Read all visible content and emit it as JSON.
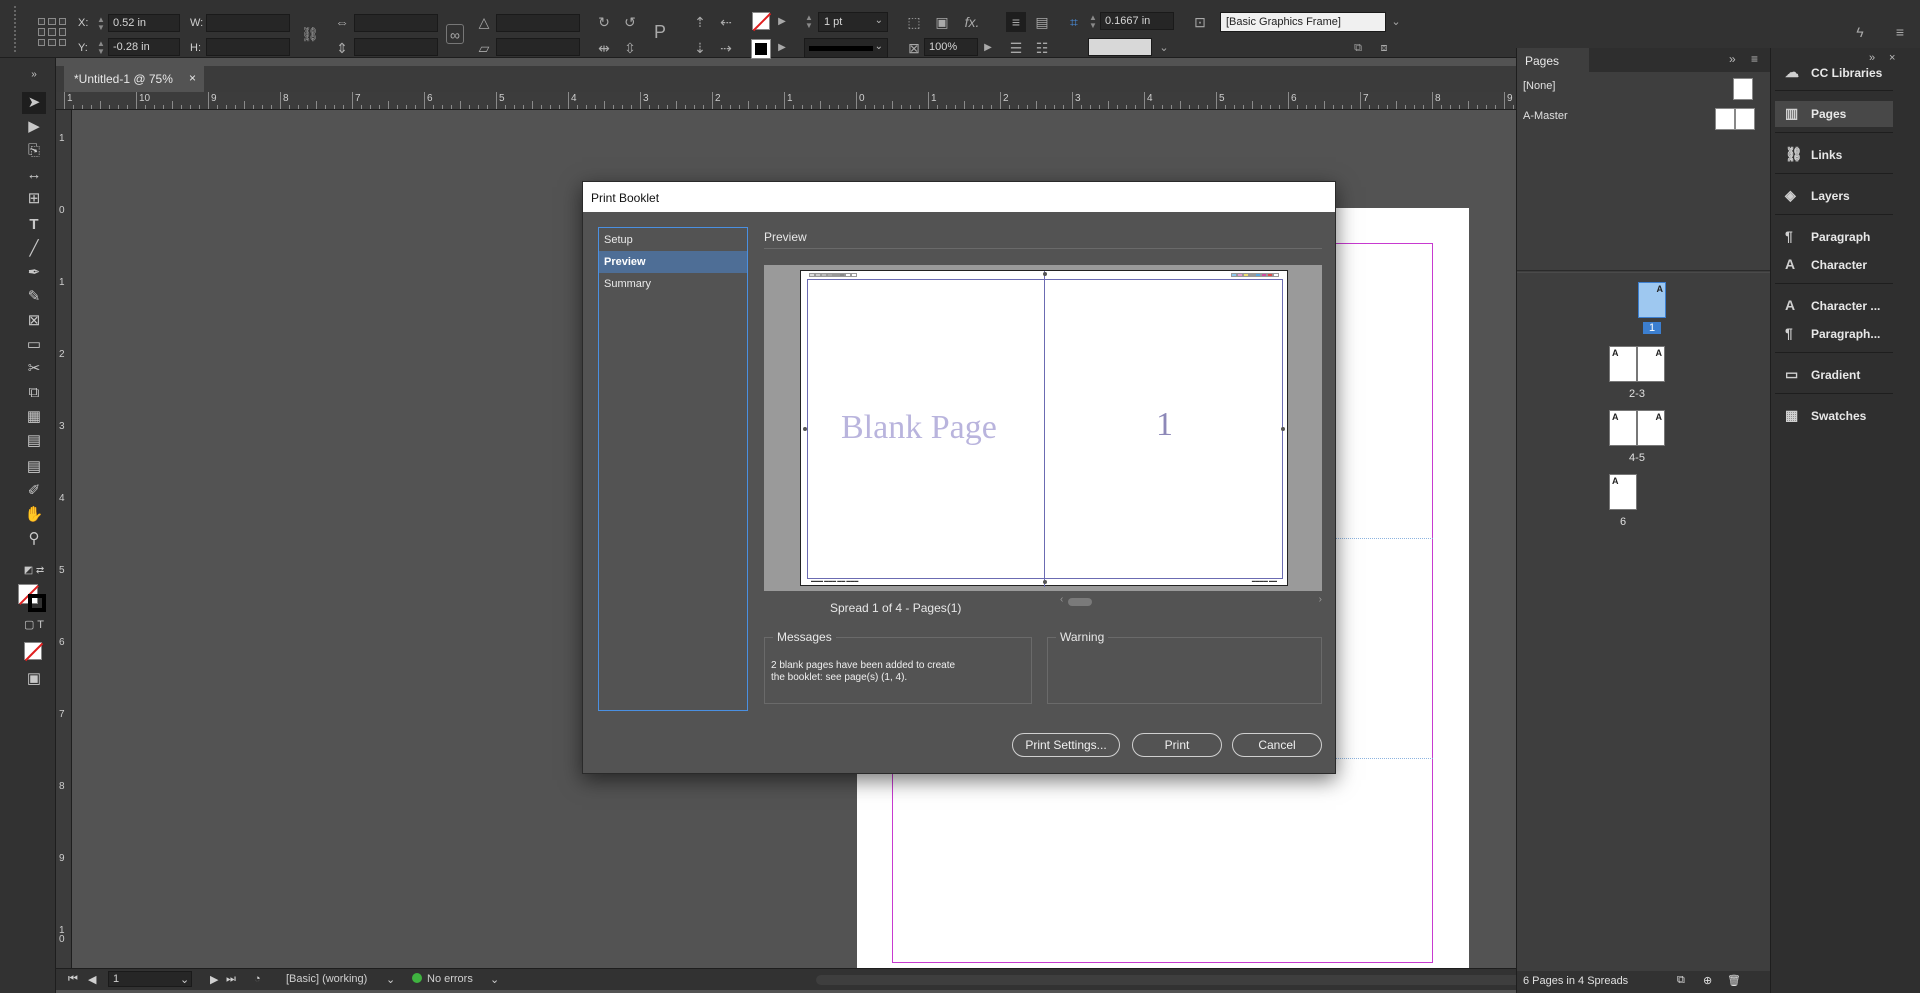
{
  "control_bar": {
    "x_label": "X:",
    "x_value": "0.52 in",
    "y_label": "Y:",
    "y_value": "-0.28 in",
    "w_label": "W:",
    "h_label": "H:",
    "stroke_weight": "1 pt",
    "scale_percent": "100%",
    "offset_value": "0.1667 in",
    "object_style": "[Basic Graphics Frame]"
  },
  "document_tab": {
    "title": "*Untitled-1 @ 75%",
    "close_glyph": "×"
  },
  "ruler": {
    "horizontal": [
      "1",
      "10",
      "9",
      "8",
      "7",
      "6",
      "5",
      "4",
      "3",
      "2",
      "1",
      "0",
      "1",
      "2",
      "3",
      "4",
      "5",
      "6",
      "7",
      "8",
      "9"
    ],
    "vertical": [
      "1",
      "0",
      "1",
      "2",
      "3",
      "4",
      "5",
      "6",
      "7",
      "8",
      "9",
      "1\n0"
    ]
  },
  "status_bar": {
    "page_number": "1",
    "preflight_profile": "[Basic] (working)",
    "errors": "No errors",
    "error_color": "#3fb340"
  },
  "pages_panel": {
    "title": "Pages",
    "masters": [
      {
        "label": "[None]"
      },
      {
        "label": "A-Master"
      }
    ],
    "thumbnails": [
      {
        "label": "1",
        "selected": true
      },
      {
        "label": "2-3"
      },
      {
        "label": "4-5"
      },
      {
        "label": "6"
      }
    ],
    "footer": "6 Pages in 4 Spreads"
  },
  "dock": {
    "items": [
      {
        "label": "CC Libraries",
        "icon": "cc-libraries-icon"
      },
      {
        "label": "Pages",
        "icon": "pages-icon",
        "active": true
      },
      {
        "label": "Links",
        "icon": "links-icon"
      },
      {
        "label": "Layers",
        "icon": "layers-icon"
      },
      {
        "label": "Paragraph",
        "icon": "paragraph-icon"
      },
      {
        "label": "Character",
        "icon": "character-icon"
      },
      {
        "label": "Character ...",
        "icon": "character-styles-icon"
      },
      {
        "label": "Paragraph...",
        "icon": "paragraph-styles-icon"
      },
      {
        "label": "Gradient",
        "icon": "gradient-icon"
      },
      {
        "label": "Swatches",
        "icon": "swatches-icon"
      }
    ]
  },
  "dialog": {
    "title": "Print Booklet",
    "nav": [
      {
        "label": "Setup"
      },
      {
        "label": "Preview",
        "active": true
      },
      {
        "label": "Summary"
      }
    ],
    "section_title": "Preview",
    "preview": {
      "left_page_text": "Blank Page",
      "right_page_text": "1"
    },
    "spread_caption": "Spread 1 of 4 - Pages(1)",
    "messages_title": "Messages",
    "messages_text": "2 blank pages have been added to create the booklet: see page(s) (1, 4).",
    "warning_title": "Warning",
    "buttons": {
      "print_settings": "Print Settings...",
      "print": "Print",
      "cancel": "Cancel"
    },
    "accent_color": "#4a90e2"
  }
}
